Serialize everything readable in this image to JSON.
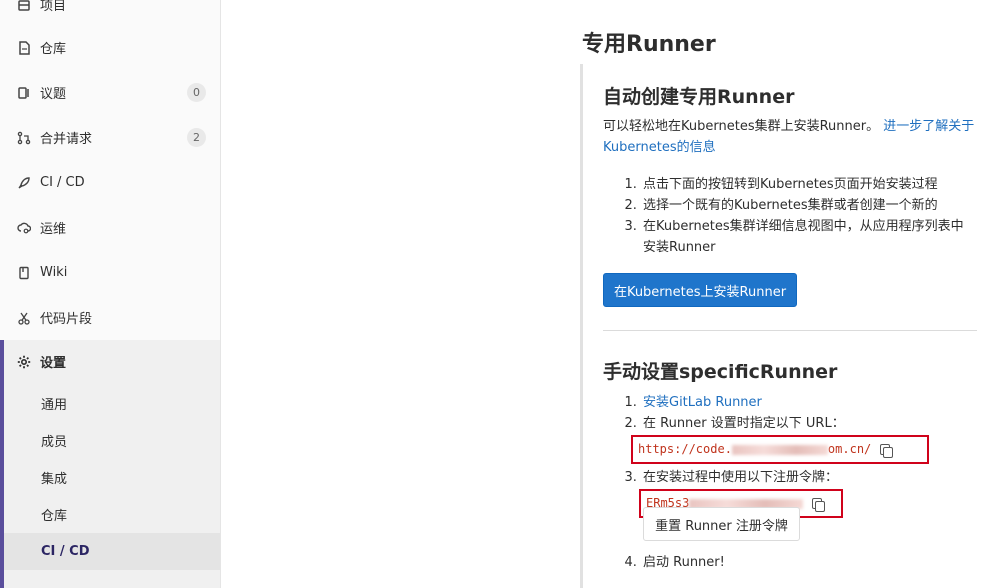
{
  "sidebar": {
    "items": [
      {
        "label": "项目",
        "icon": "project-icon"
      },
      {
        "label": "仓库",
        "icon": "file-icon"
      },
      {
        "label": "议题",
        "icon": "issues-icon",
        "badge": "0"
      },
      {
        "label": "合并请求",
        "icon": "merge-request-icon",
        "badge": "2"
      },
      {
        "label": "CI / CD",
        "icon": "rocket-icon"
      },
      {
        "label": "运维",
        "icon": "cloud-gear-icon"
      },
      {
        "label": "Wiki",
        "icon": "book-icon"
      },
      {
        "label": "代码片段",
        "icon": "scissors-icon"
      }
    ],
    "settings": {
      "label": "设置",
      "icon": "gear-icon",
      "subitems": [
        {
          "label": "通用"
        },
        {
          "label": "成员"
        },
        {
          "label": "集成"
        },
        {
          "label": "仓库"
        },
        {
          "label": "CI / CD",
          "active": true
        }
      ]
    }
  },
  "main": {
    "title": "专用Runner",
    "auto": {
      "heading": "自动创建专用Runner",
      "intro": "可以轻松地在Kubernetes集群上安装Runner。",
      "intro_link": "进一步了解关于Kubernetes的信息",
      "steps": [
        "点击下面的按钮转到Kubernetes页面开始安装过程",
        "选择一个既有的Kubernetes集群或者创建一个新的",
        "在Kubernetes集群详细信息视图中，从应用程序列表中安装Runner"
      ],
      "button": "在Kubernetes上安装Runner"
    },
    "manual": {
      "heading": "手动设置specificRunner",
      "step1_link": "安装GitLab Runner",
      "step2": "在 Runner 设置时指定以下 URL：",
      "url_start": "https://code.",
      "url_end": "om.cn/",
      "step3": "在安装过程中使用以下注册令牌：",
      "token_start": "ERm5s3",
      "reset_button": "重置 Runner 注册令牌",
      "step4": "启动 Runner!"
    }
  },
  "colors": {
    "accent": "#1f75cb",
    "active_bar": "#5a4e9c",
    "highlight_box": "#d0021b"
  }
}
